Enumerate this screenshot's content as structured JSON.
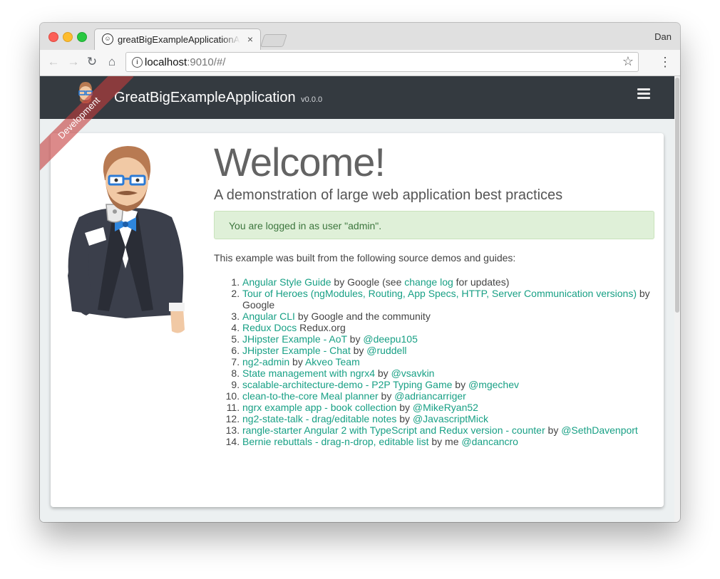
{
  "browser": {
    "tab_title": "greatBigExampleApplicationApp",
    "tab_close": "×",
    "profile_name": "Dan",
    "url_host": "localhost",
    "url_rest": ":9010/#/",
    "icons": {
      "back": "back-arrow-icon",
      "forward": "forward-arrow-icon",
      "reload": "reload-icon",
      "home": "home-icon",
      "info": "info-icon",
      "star": "bookmark-star-icon",
      "menu": "three-dots-menu-icon"
    }
  },
  "app": {
    "brand": "GreatBigExampleApplication",
    "version": "v0.0.0",
    "ribbon": "Development",
    "nav_color": "#343a40",
    "link_color": "#18a085"
  },
  "home": {
    "title": "Welcome!",
    "subtitle": "A demonstration of large web application best practices",
    "alert": "You are logged in as user \"admin\".",
    "intro": "This example was built from the following source demos and guides:",
    "sources": [
      [
        {
          "t": "Angular Style Guide",
          "link": true
        },
        {
          "t": " by Google (see "
        },
        {
          "t": "change log",
          "link": true
        },
        {
          "t": " for updates)"
        }
      ],
      [
        {
          "t": "Tour of Heroes (ngModules, Routing, App Specs, HTTP, Server Communication versions)",
          "link": true
        },
        {
          "t": " by Google"
        }
      ],
      [
        {
          "t": "Angular CLI",
          "link": true
        },
        {
          "t": " by Google and the community"
        }
      ],
      [
        {
          "t": "Redux Docs",
          "link": true
        },
        {
          "t": " Redux.org"
        }
      ],
      [
        {
          "t": "JHipster Example - AoT",
          "link": true
        },
        {
          "t": " by "
        },
        {
          "t": "@deepu105",
          "link": true
        }
      ],
      [
        {
          "t": "JHipster Example - Chat",
          "link": true
        },
        {
          "t": " by "
        },
        {
          "t": "@ruddell",
          "link": true
        }
      ],
      [
        {
          "t": "ng2-admin",
          "link": true
        },
        {
          "t": " by "
        },
        {
          "t": "Akveo Team",
          "link": true
        }
      ],
      [
        {
          "t": "State management with ngrx4",
          "link": true
        },
        {
          "t": " by "
        },
        {
          "t": "@vsavkin",
          "link": true
        }
      ],
      [
        {
          "t": "scalable-architecture-demo - P2P Typing Game",
          "link": true
        },
        {
          "t": " by "
        },
        {
          "t": "@mgechev",
          "link": true
        }
      ],
      [
        {
          "t": "clean-to-the-core Meal planner",
          "link": true
        },
        {
          "t": " by "
        },
        {
          "t": "@adriancarriger",
          "link": true
        }
      ],
      [
        {
          "t": "ngrx example app - book collection",
          "link": true
        },
        {
          "t": " by "
        },
        {
          "t": "@MikeRyan52",
          "link": true
        }
      ],
      [
        {
          "t": "ng2-state-talk - drag/editable notes",
          "link": true
        },
        {
          "t": " by "
        },
        {
          "t": "@JavascriptMick",
          "link": true
        }
      ],
      [
        {
          "t": "rangle-starter Angular 2 with TypeScript and Redux version - counter",
          "link": true
        },
        {
          "t": " by "
        },
        {
          "t": "@SethDavenport",
          "link": true
        }
      ],
      [
        {
          "t": "Bernie rebuttals - drag-n-drop, editable list",
          "link": true
        },
        {
          "t": " by me "
        },
        {
          "t": "@dancancro",
          "link": true
        }
      ]
    ]
  }
}
